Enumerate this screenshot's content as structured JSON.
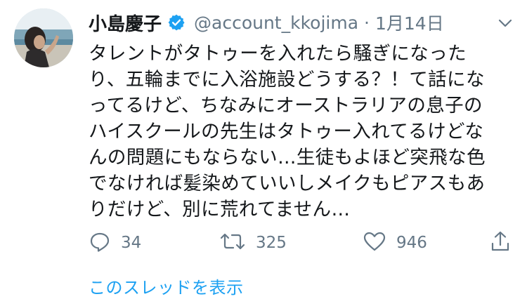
{
  "tweet": {
    "display_name": "小島慶子",
    "handle": "@account_kkojima",
    "separator": "·",
    "date": "1月14日",
    "text": "タレントがタトゥーを入れたら騒ぎになった\nり、五輪までに入浴施設どうする？！て話にな\nってるけど、ちなみにオーストラリアの息子の\nハイスクールの先生はタトゥー入れてるけどな\nんの問題にもならない…生徒もよほど突飛な色\nでなければ髪染めていいしメイクもピアスもあ\nりだけど、別に荒れてません…",
    "actions": {
      "reply_count": "34",
      "retweet_count": "325",
      "like_count": "946"
    },
    "show_thread_label": "このスレッドを表示"
  },
  "icons": {
    "verified": "verified-badge-icon",
    "more": "chevron-down-icon",
    "reply": "reply-icon",
    "retweet": "retweet-icon",
    "like": "heart-icon",
    "share": "share-icon"
  },
  "colors": {
    "accent": "#1da1f2",
    "secondary_text": "#657786",
    "primary_text": "#14171a"
  }
}
